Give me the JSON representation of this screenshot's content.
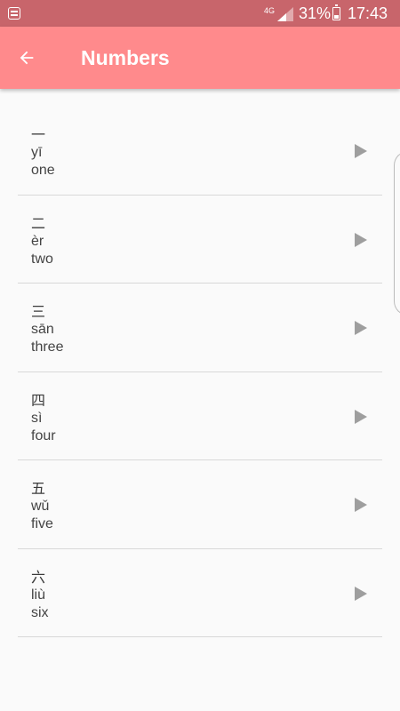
{
  "status_bar": {
    "network": "4G",
    "battery": "31%",
    "time": "17:43",
    "icons": [
      "notification-icon",
      "signal-icon",
      "battery-icon"
    ]
  },
  "app_bar": {
    "back_icon": "arrow-left-icon",
    "title": "Numbers",
    "color": "#ff8a8c"
  },
  "list": {
    "items": [
      {
        "hanzi": "一",
        "pinyin": "yī",
        "english": "one"
      },
      {
        "hanzi": "二",
        "pinyin": "èr",
        "english": "two"
      },
      {
        "hanzi": "三",
        "pinyin": "sān",
        "english": "three"
      },
      {
        "hanzi": "四",
        "pinyin": "sì",
        "english": "four"
      },
      {
        "hanzi": "五",
        "pinyin": "wǔ",
        "english": "five"
      },
      {
        "hanzi": "六",
        "pinyin": "liù",
        "english": "six"
      }
    ],
    "play_icon": "play-icon"
  }
}
